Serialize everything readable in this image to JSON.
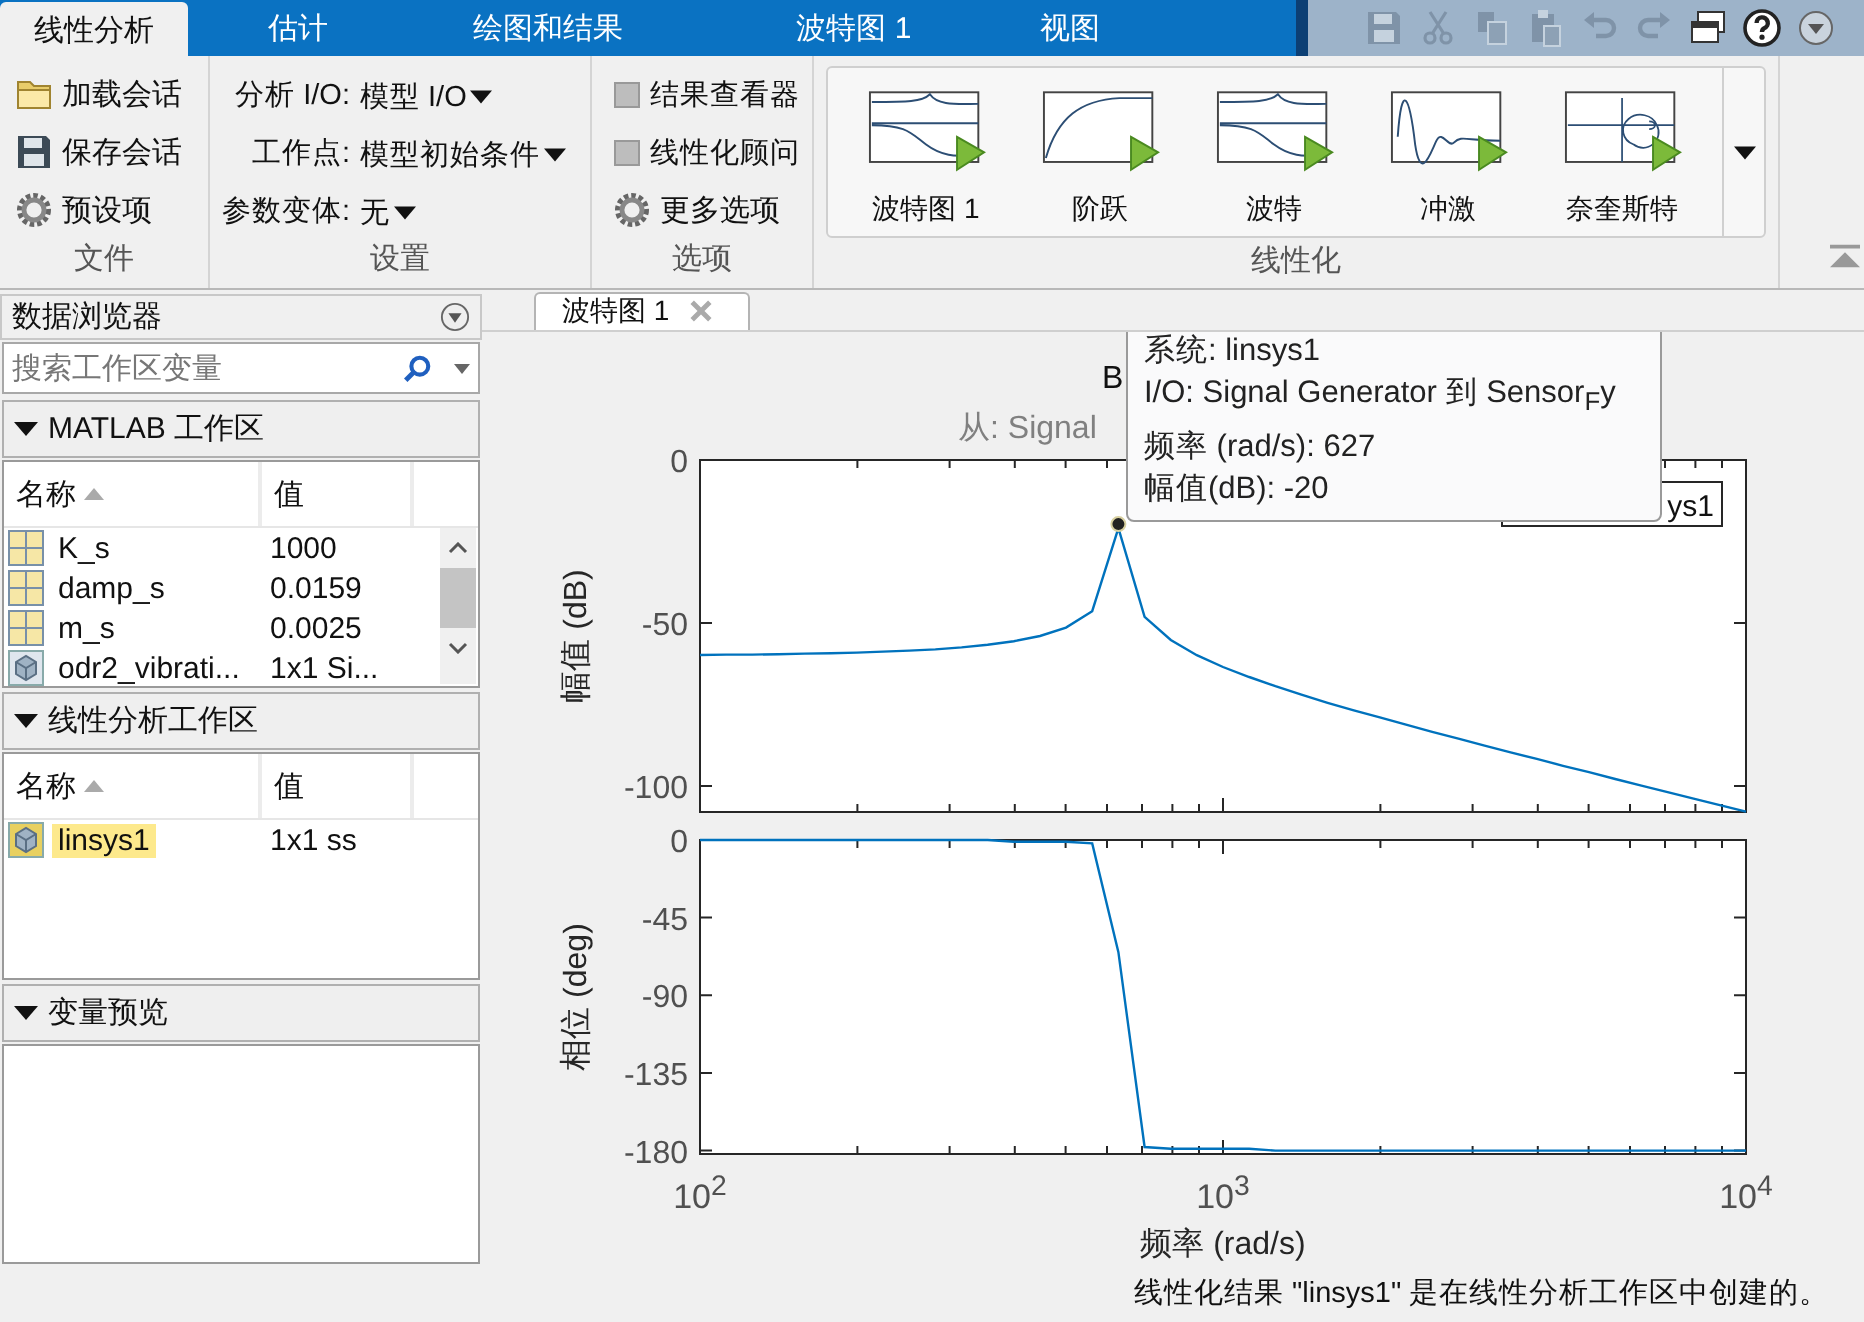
{
  "ribbon_tabs": [
    {
      "label": "线性分析",
      "selected": true
    },
    {
      "label": "估计",
      "selected": false
    },
    {
      "label": "绘图和结果",
      "selected": false
    },
    {
      "label": "波特图 1",
      "selected": false
    },
    {
      "label": "视图",
      "selected": false
    }
  ],
  "file_section": {
    "title": "文件",
    "items": [
      {
        "label": "加载会话"
      },
      {
        "label": "保存会话"
      },
      {
        "label": "预设项"
      }
    ]
  },
  "settings_section": {
    "title": "设置",
    "rows": [
      {
        "label": "分析 I/O:",
        "value": "模型 I/O"
      },
      {
        "label": "工作点:",
        "value": "模型初始条件"
      },
      {
        "label": "参数变体:",
        "value": "无"
      }
    ]
  },
  "options_section": {
    "title": "选项",
    "items": [
      {
        "kind": "checkbox",
        "label": "结果查看器",
        "checked": false
      },
      {
        "kind": "checkbox",
        "label": "线性化顾问",
        "checked": false
      },
      {
        "kind": "button",
        "label": "更多选项"
      }
    ]
  },
  "linearize_section": {
    "title": "线性化",
    "items": [
      {
        "label": "波特图 1"
      },
      {
        "label": "阶跃"
      },
      {
        "label": "波特"
      },
      {
        "label": "冲激"
      },
      {
        "label": "奈奎斯特"
      }
    ]
  },
  "data_browser": {
    "title": "数据浏览器",
    "search": {
      "placeholder": "搜索工作区变量"
    },
    "sections": [
      {
        "title": "MATLAB 工作区",
        "expanded": true,
        "columns": [
          "名称",
          "值"
        ],
        "rows": [
          {
            "kind": "matrix",
            "name": "K_s",
            "value": "1000",
            "selected": false
          },
          {
            "kind": "matrix",
            "name": "damp_s",
            "value": "0.0159",
            "selected": false
          },
          {
            "kind": "matrix",
            "name": "m_s",
            "value": "0.0025",
            "selected": false
          },
          {
            "kind": "object",
            "name": "odr2_vibrati...",
            "value": "1x1 Si...",
            "selected": false
          }
        ]
      },
      {
        "title": "线性分析工作区",
        "expanded": true,
        "columns": [
          "名称",
          "值"
        ],
        "rows": [
          {
            "kind": "object",
            "name": "linsys1",
            "value": "1x1 ss",
            "selected": true
          }
        ]
      },
      {
        "title": "变量预览",
        "expanded": true
      }
    ]
  },
  "document_tab": {
    "label": "波特图 1",
    "selected": true
  },
  "figure": {
    "title": "B",
    "subtitle": "从: Signal",
    "datatip": {
      "lines": [
        "系统: linsys1",
        "I/O: Signal Generator 到 Sensor$_{F}$y",
        "频率 (rad/s): 627",
        "幅值(dB): -20"
      ]
    },
    "magnitude_plot": {
      "chart_data": {
        "type": "line",
        "ylabel": "幅值 (dB)",
        "series": [
          {
            "name": "ys1",
            "color": "#0072bd",
            "values": [
              -59.8,
              -59.7,
              -59.7,
              -59.6,
              -59.4,
              -59.3,
              -59.1,
              -58.8,
              -58.5,
              -58.1,
              -57.5,
              -56.7,
              -55.6,
              -54.0,
              -51.4,
              -46.4,
              -20.9,
              -48.1,
              -55.2,
              -59.9,
              -63.5,
              -66.6,
              -69.4,
              -72.0,
              -74.5,
              -76.8,
              -79.0,
              -81.2,
              -83.4,
              -85.5,
              -87.6,
              -89.7,
              -91.7,
              -93.8,
              -95.8,
              -97.9,
              -99.9,
              -101.9,
              -103.9,
              -105.9,
              -107.9
            ]
          }
        ],
        "ylim": [
          -108,
          0
        ],
        "yticks": [
          0,
          -50,
          -100
        ]
      }
    },
    "phase_plot": {
      "chart_data": {
        "type": "line",
        "xlabel": "频率  (rad/s)",
        "ylabel": "相位 (deg)",
        "categories": [
          "10$^{2}$",
          null,
          null,
          null,
          null,
          null,
          null,
          null,
          null,
          null,
          null,
          null,
          null,
          null,
          null,
          null,
          null,
          null,
          null,
          null,
          "10$^{3}$",
          null,
          null,
          null,
          null,
          null,
          null,
          null,
          null,
          null,
          null,
          null,
          null,
          null,
          null,
          null,
          null,
          null,
          null,
          null,
          "10$^{4}$"
        ],
        "series": [
          {
            "color": "#0072bd",
            "values": [
              0,
              0,
              0,
              0,
              0,
              0,
              0,
              0,
              0,
              0,
              0,
              0,
              -1,
              -1,
              -1,
              -2,
              -65,
              -178,
              -179,
              -179,
              -179,
              -179,
              -180,
              -180,
              -180,
              -180,
              -180,
              -180,
              -180,
              -180,
              -180,
              -180,
              -180,
              -180,
              -180,
              -180,
              -180,
              -180,
              -180,
              -180,
              -180
            ]
          }
        ],
        "ylim": [
          -182,
          0
        ],
        "yticks": [
          0,
          -45,
          -90,
          -135,
          -180
        ]
      }
    }
  },
  "status": "线性化结果 \"linsys1\" 是在线性分析工作区中创建的。"
}
